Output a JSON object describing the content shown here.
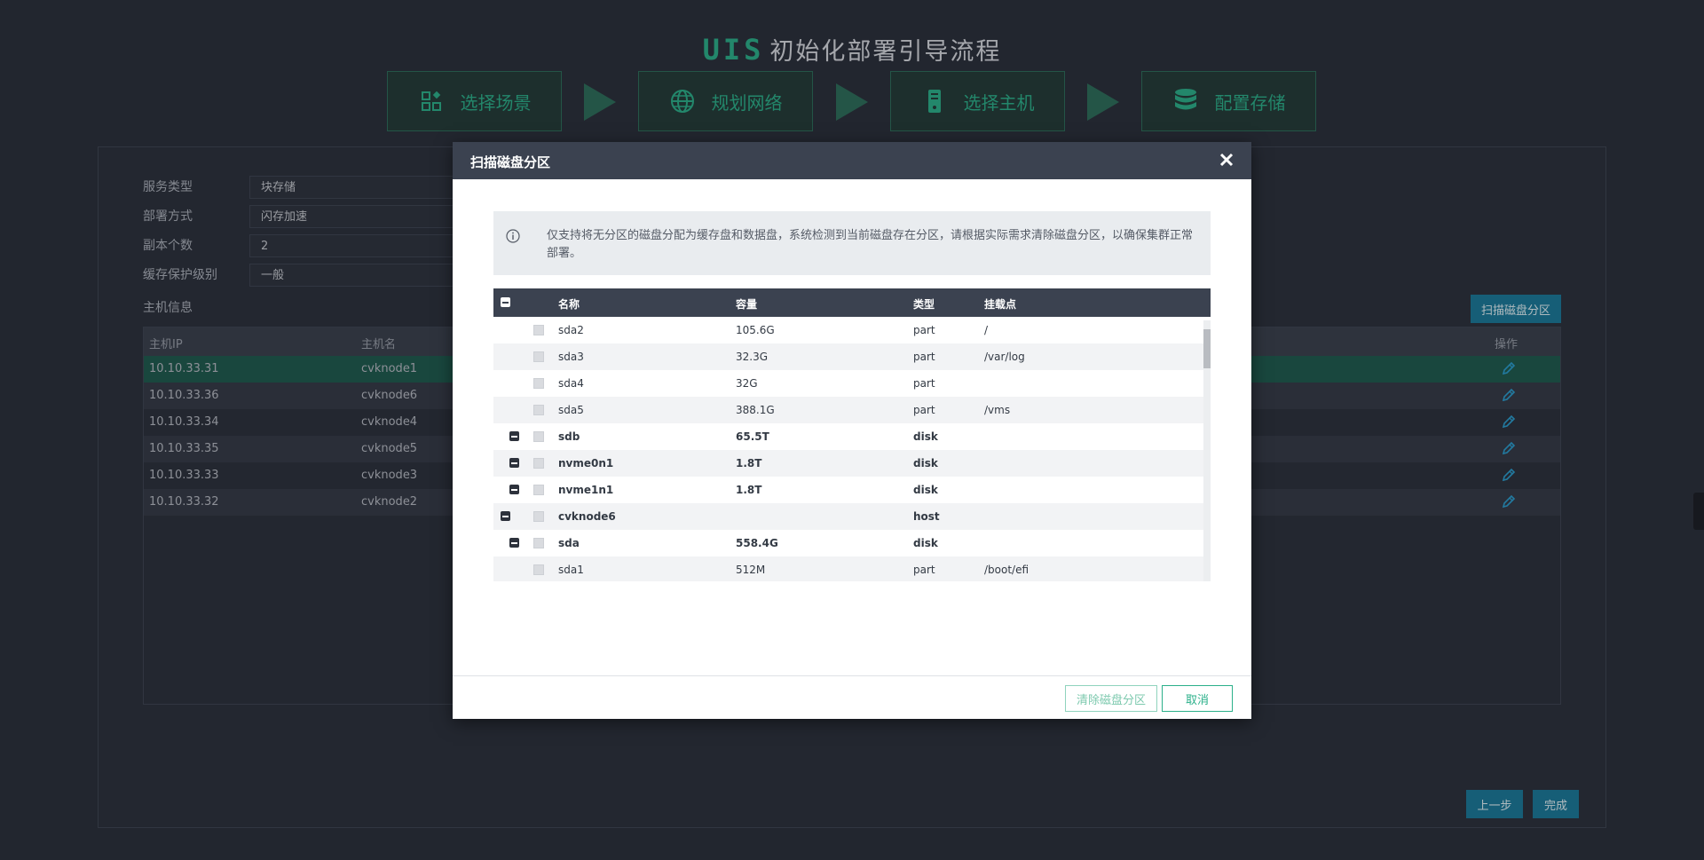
{
  "header": {
    "logo": "UIS",
    "title": "初始化部署引导流程"
  },
  "steps": [
    {
      "label": "选择场景",
      "icon": "scene-icon"
    },
    {
      "label": "规划网络",
      "icon": "globe-icon"
    },
    {
      "label": "选择主机",
      "icon": "server-icon"
    },
    {
      "label": "配置存储",
      "icon": "database-icon"
    }
  ],
  "form": {
    "service_type_label": "服务类型",
    "service_type_value": "块存储",
    "deploy_mode_label": "部署方式",
    "deploy_mode_value": "闪存加速",
    "replica_label": "副本个数",
    "replica_value": "2",
    "cache_level_label": "缓存保护级别",
    "cache_level_value": "一般"
  },
  "hosts": {
    "section_label": "主机信息",
    "scan_button": "扫描磁盘分区",
    "columns": {
      "ip": "主机IP",
      "name": "主机名",
      "action": "操作"
    },
    "rows": [
      {
        "ip": "10.10.33.31",
        "name": "cvknode1"
      },
      {
        "ip": "10.10.33.36",
        "name": "cvknode6"
      },
      {
        "ip": "10.10.33.34",
        "name": "cvknode4"
      },
      {
        "ip": "10.10.33.35",
        "name": "cvknode5"
      },
      {
        "ip": "10.10.33.33",
        "name": "cvknode3"
      },
      {
        "ip": "10.10.33.32",
        "name": "cvknode2"
      }
    ]
  },
  "nav": {
    "prev": "上一步",
    "finish": "完成"
  },
  "modal": {
    "title": "扫描磁盘分区",
    "notice": "仅支持将无分区的磁盘分配为缓存盘和数据盘，系统检测到当前磁盘存在分区，请根据实际需求清除磁盘分区，以确保集群正常部署。",
    "columns": {
      "name": "名称",
      "capacity": "容量",
      "type": "类型",
      "mount": "挂载点"
    },
    "rows": [
      {
        "name": "sda2",
        "capacity": "105.6G",
        "type": "part",
        "mount": "/",
        "level": 2,
        "bold": false
      },
      {
        "name": "sda3",
        "capacity": "32.3G",
        "type": "part",
        "mount": "/var/log",
        "level": 2,
        "bold": false
      },
      {
        "name": "sda4",
        "capacity": "32G",
        "type": "part",
        "mount": "",
        "level": 2,
        "bold": false
      },
      {
        "name": "sda5",
        "capacity": "388.1G",
        "type": "part",
        "mount": "/vms",
        "level": 2,
        "bold": false
      },
      {
        "name": "sdb",
        "capacity": "65.5T",
        "type": "disk",
        "mount": "",
        "level": 1,
        "bold": true
      },
      {
        "name": "nvme0n1",
        "capacity": "1.8T",
        "type": "disk",
        "mount": "",
        "level": 1,
        "bold": true
      },
      {
        "name": "nvme1n1",
        "capacity": "1.8T",
        "type": "disk",
        "mount": "",
        "level": 1,
        "bold": true
      },
      {
        "name": "cvknode6",
        "capacity": "",
        "type": "host",
        "mount": "",
        "level": 0,
        "bold": true
      },
      {
        "name": "sda",
        "capacity": "558.4G",
        "type": "disk",
        "mount": "",
        "level": 1,
        "bold": true
      },
      {
        "name": "sda1",
        "capacity": "512M",
        "type": "part",
        "mount": "/boot/efi",
        "level": 2,
        "bold": false
      }
    ],
    "clear_button": "清除磁盘分区",
    "cancel_button": "取消"
  }
}
